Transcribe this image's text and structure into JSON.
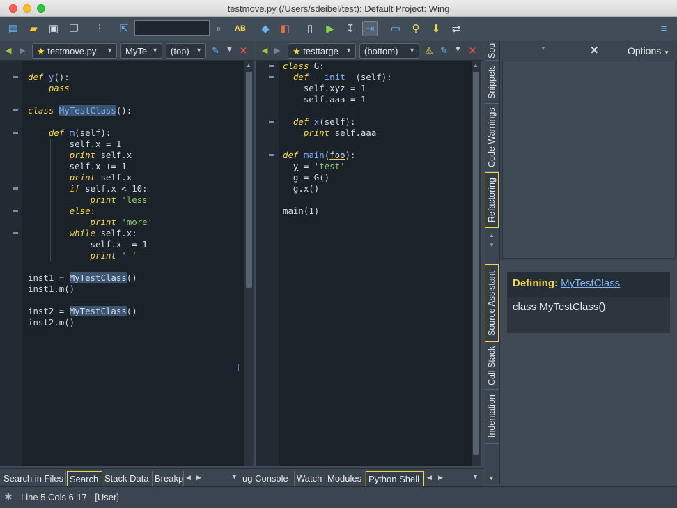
{
  "window": {
    "title": "testmove.py (/Users/sdeibel/test): Default Project: Wing"
  },
  "toolbar": {
    "search_value": ""
  },
  "left_editor": {
    "file_tab": "testmove.py",
    "scope_1": "MyTe",
    "scope_2": "(top)",
    "lines": [
      "def y():",
      "    pass",
      "",
      "class MyTestClass():",
      "",
      "    def m(self):",
      "        self.x = 1",
      "        print self.x",
      "        self.x += 1",
      "        print self.x",
      "        if self.x < 10:",
      "            print 'less'",
      "        else:",
      "            print 'more'",
      "        while self.x:",
      "            self.x -= 1",
      "            print '-'",
      "",
      "inst1 = MyTestClass()",
      "inst1.m()",
      "",
      "inst2 = MyTestClass()",
      "inst2.m()"
    ]
  },
  "right_editor": {
    "file_tab": "testtarge",
    "scope_1": "(bottom)",
    "lines": [
      "class G:",
      "  def __init__(self):",
      "    self.xyz = 1",
      "    self.aaa = 1",
      "",
      "  def x(self):",
      "    print self.aaa",
      "",
      "def main(foo):",
      "  y = 'test'",
      "  g = G()",
      "  g.x()",
      "",
      "main(1)"
    ]
  },
  "side_tabs": {
    "top": [
      "Sou",
      "Snippets",
      "Code Warnings",
      "Refactoring"
    ],
    "bottom": [
      "Source Assistant",
      "Call Stack",
      "Indentation"
    ]
  },
  "refactor_panel": {
    "options_label": "Options"
  },
  "source_assistant": {
    "defining_label": "Defining:",
    "defining_link": "MyTestClass",
    "signature": "class MyTestClass()"
  },
  "bottom_tabs_left": [
    "Search in Files",
    "Search",
    "Stack Data",
    "Breakp"
  ],
  "bottom_tabs_right": [
    "ug Console",
    "Watch",
    "Modules",
    "Python Shell"
  ],
  "status": {
    "text": "Line 5 Cols 6-17 - [User]"
  }
}
